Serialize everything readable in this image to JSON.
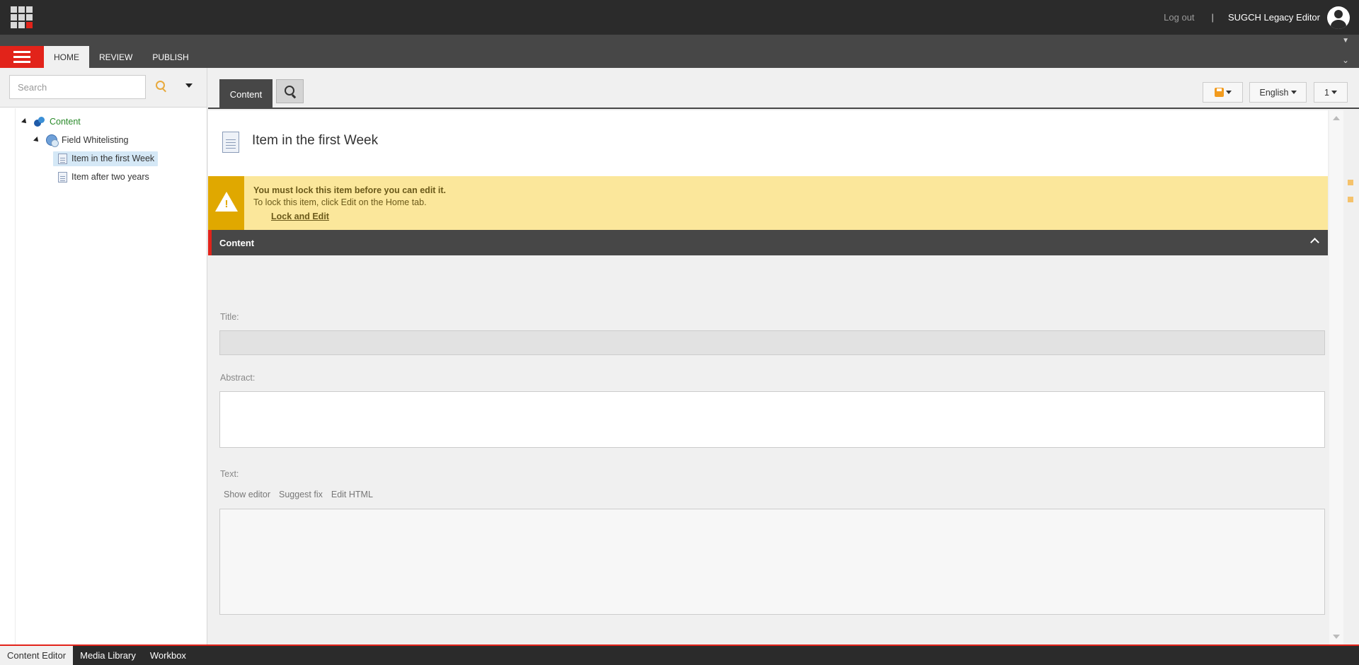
{
  "topbar": {
    "logout": "Log out",
    "separator": "|",
    "username": "SUGCH Legacy Editor"
  },
  "ribbon": {
    "tabs": [
      {
        "label": "HOME",
        "active": true
      },
      {
        "label": "REVIEW",
        "active": false
      },
      {
        "label": "PUBLISH",
        "active": false
      }
    ]
  },
  "search": {
    "placeholder": "Search"
  },
  "tree": {
    "items": [
      {
        "label": "Content",
        "icon": "content-icon",
        "level": 0
      },
      {
        "label": "Field Whitelisting",
        "icon": "globe-icon",
        "level": 1
      },
      {
        "label": "Item in the first Week",
        "icon": "document-icon",
        "level": 2,
        "selected": true
      },
      {
        "label": "Item after two years",
        "icon": "document-icon",
        "level": 2
      }
    ]
  },
  "editor_tabs": {
    "content_label": "Content",
    "language": "English",
    "version": "1"
  },
  "item": {
    "title": "Item in the first Week"
  },
  "warning": {
    "title": "You must lock this item before you can edit it.",
    "subtitle": "To lock this item, click Edit on the Home tab.",
    "link": "Lock and Edit"
  },
  "section": {
    "title": "Content"
  },
  "fields": {
    "title_label": "Title:",
    "abstract_label": "Abstract:",
    "text_label": "Text:",
    "text_actions": [
      "Show editor",
      "Suggest fix",
      "Edit HTML"
    ]
  },
  "bottom_tabs": [
    {
      "label": "Content Editor",
      "active": true
    },
    {
      "label": "Media Library",
      "active": false
    },
    {
      "label": "Workbox",
      "active": false
    }
  ],
  "colors": {
    "brand_red": "#e2231a",
    "warning_bg": "#fbe79b",
    "warning_accent": "#e0a800",
    "dark_bar": "#2b2b2b"
  }
}
